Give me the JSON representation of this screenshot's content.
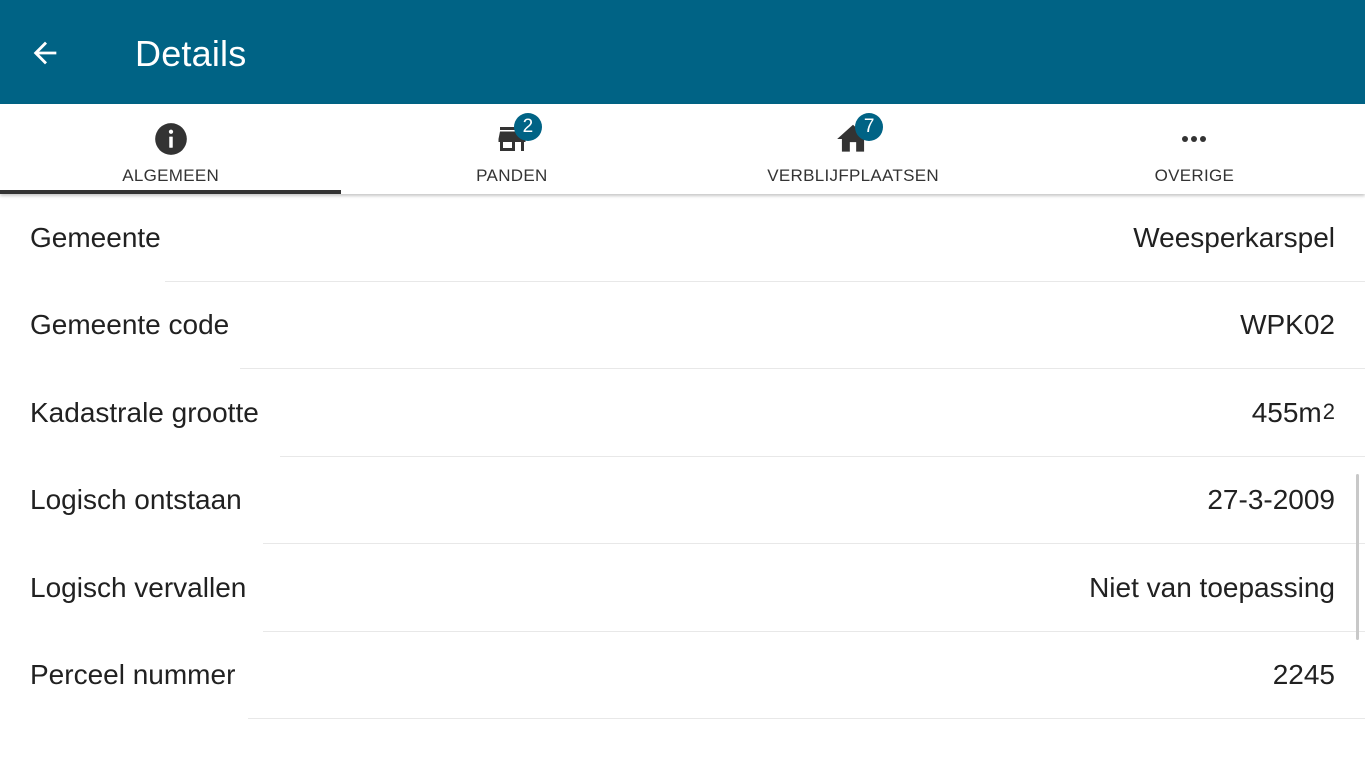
{
  "appbar": {
    "title": "Details",
    "back_icon": "arrow-back-icon",
    "background": "#006385"
  },
  "tabs": [
    {
      "label": "ALGEMEEN",
      "icon": "info-icon",
      "badge": null,
      "active": true
    },
    {
      "label": "PANDEN",
      "icon": "store-icon",
      "badge": "2",
      "active": false
    },
    {
      "label": "VERBLIJFPLAATSEN",
      "icon": "home-icon",
      "badge": "7",
      "active": false
    },
    {
      "label": "OVERIGE",
      "icon": "more-horiz-icon",
      "badge": null,
      "active": false
    }
  ],
  "details": [
    {
      "label": "Gemeente",
      "value": "Weesperkarspel"
    },
    {
      "label": "Gemeente code",
      "value": "WPK02"
    },
    {
      "label": "Kadastrale grootte",
      "value": "455m",
      "value_sup": "2"
    },
    {
      "label": "Logisch ontstaan",
      "value": "27-3-2009"
    },
    {
      "label": "Logisch vervallen",
      "value": "Niet van toepassing"
    },
    {
      "label": "Perceel nummer",
      "value": "2245"
    }
  ],
  "colors": {
    "accent": "#006385",
    "text": "#212121",
    "tab_text": "#333333",
    "divider": "#e8e8e8"
  }
}
